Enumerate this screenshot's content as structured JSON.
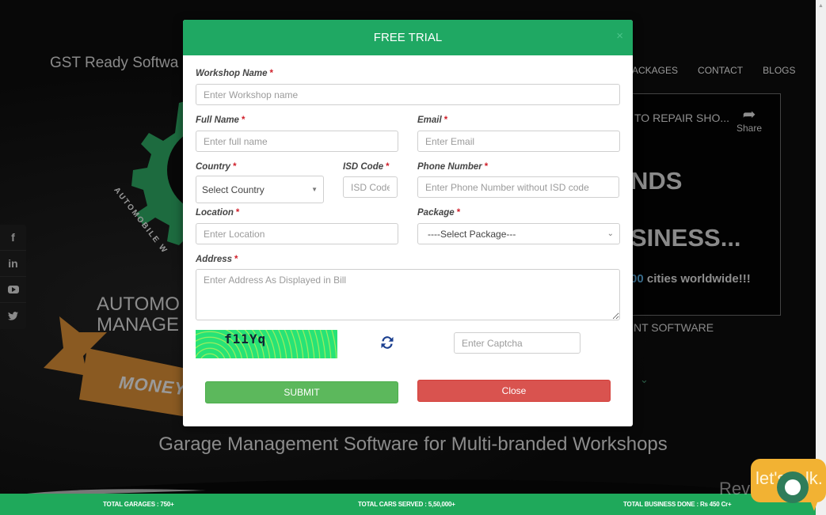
{
  "background": {
    "tagline": "GST Ready Softwa",
    "nav": [
      "ACKAGES",
      "CONTACT",
      "BLOGS"
    ],
    "logo_ring_text": "AUTOMOBILE W",
    "hero_title_lines": [
      "AUTOMO",
      "MANAGE"
    ],
    "ribbon_text": "MONEY",
    "social": [
      {
        "icon": "facebook-icon",
        "glyph": "f"
      },
      {
        "icon": "linkedin-icon",
        "glyph": "in"
      },
      {
        "icon": "youtube-icon",
        "glyph": "▶"
      },
      {
        "icon": "twitter-icon",
        "glyph": "🐦"
      }
    ],
    "video": {
      "title": "TO REPAIR SHO...",
      "share_label": "Share",
      "big_line1": "NDS",
      "big_line2": "SINESS...",
      "cities_num": "00",
      "cities_text": " cities worldwide!!!"
    },
    "software_label": "NT SOFTWARE",
    "subtitle": "Garage Management Software for Multi-branded Workshops",
    "stats": [
      "TOTAL GARAGES : 750+",
      "TOTAL CARS SERVED : 5,50,000+",
      "TOTAL BUSINESS DONE : Rs 450 Cr+"
    ],
    "chat_text": "let's talk.",
    "watermark": "Revain"
  },
  "modal": {
    "title": "FREE TRIAL",
    "close_x": "×",
    "fields": {
      "workshop_name": {
        "label": "Workshop Name",
        "placeholder": "Enter Workshop name",
        "value": ""
      },
      "full_name": {
        "label": "Full Name",
        "placeholder": "Enter full name",
        "value": ""
      },
      "email": {
        "label": "Email",
        "placeholder": "Enter Email",
        "value": ""
      },
      "country": {
        "label": "Country",
        "selected": "Select Country"
      },
      "isd_code": {
        "label": "ISD Code",
        "placeholder": "ISD Code",
        "value": ""
      },
      "phone": {
        "label": "Phone Number",
        "placeholder": "Enter Phone Number without ISD code",
        "value": ""
      },
      "location": {
        "label": "Location",
        "placeholder": "Enter Location",
        "value": ""
      },
      "package": {
        "label": "Package",
        "selected": "----Select Package---"
      },
      "address": {
        "label": "Address",
        "placeholder": "Enter Address As Displayed in Bill",
        "value": ""
      },
      "captcha": {
        "image_text": "f11Yq",
        "placeholder": "Enter Captcha",
        "value": ""
      }
    },
    "required_mark": "*",
    "submit_label": "SUBMIT",
    "close_label": "Close"
  },
  "colors": {
    "header_green": "#1fa863",
    "submit_green": "#5cb85c",
    "close_red": "#d9534f",
    "required_red": "#d0202b",
    "stats_green": "#1fa95b"
  }
}
